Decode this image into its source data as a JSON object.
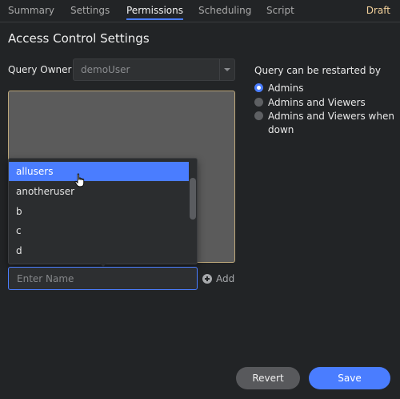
{
  "tabs": {
    "summary": "Summary",
    "settings": "Settings",
    "permissions": "Permissions",
    "scheduling": "Scheduling",
    "script": "Script",
    "active": "Permissions"
  },
  "status": {
    "draft": "Draft"
  },
  "page": {
    "title": "Access Control Settings"
  },
  "owner": {
    "label": "Query Owner",
    "value": "demoUser"
  },
  "users_dropdown": {
    "items": [
      "allusers",
      "anotheruser",
      "b",
      "c",
      "d"
    ],
    "selected": "allusers"
  },
  "name_input": {
    "placeholder": "Enter Name",
    "value": ""
  },
  "add_button": {
    "label": "Add",
    "icon": "plus-circle-icon"
  },
  "restart": {
    "label": "Query can be restarted by",
    "options": [
      "Admins",
      "Admins and Viewers",
      "Admins and Viewers when down"
    ],
    "selected": "Admins"
  },
  "footer": {
    "revert_label": "Revert",
    "save_label": "Save"
  },
  "colors": {
    "accent": "#4a7dff",
    "draft": "#f3d19b",
    "background": "#222426",
    "users_box_border": "#bca77a"
  }
}
